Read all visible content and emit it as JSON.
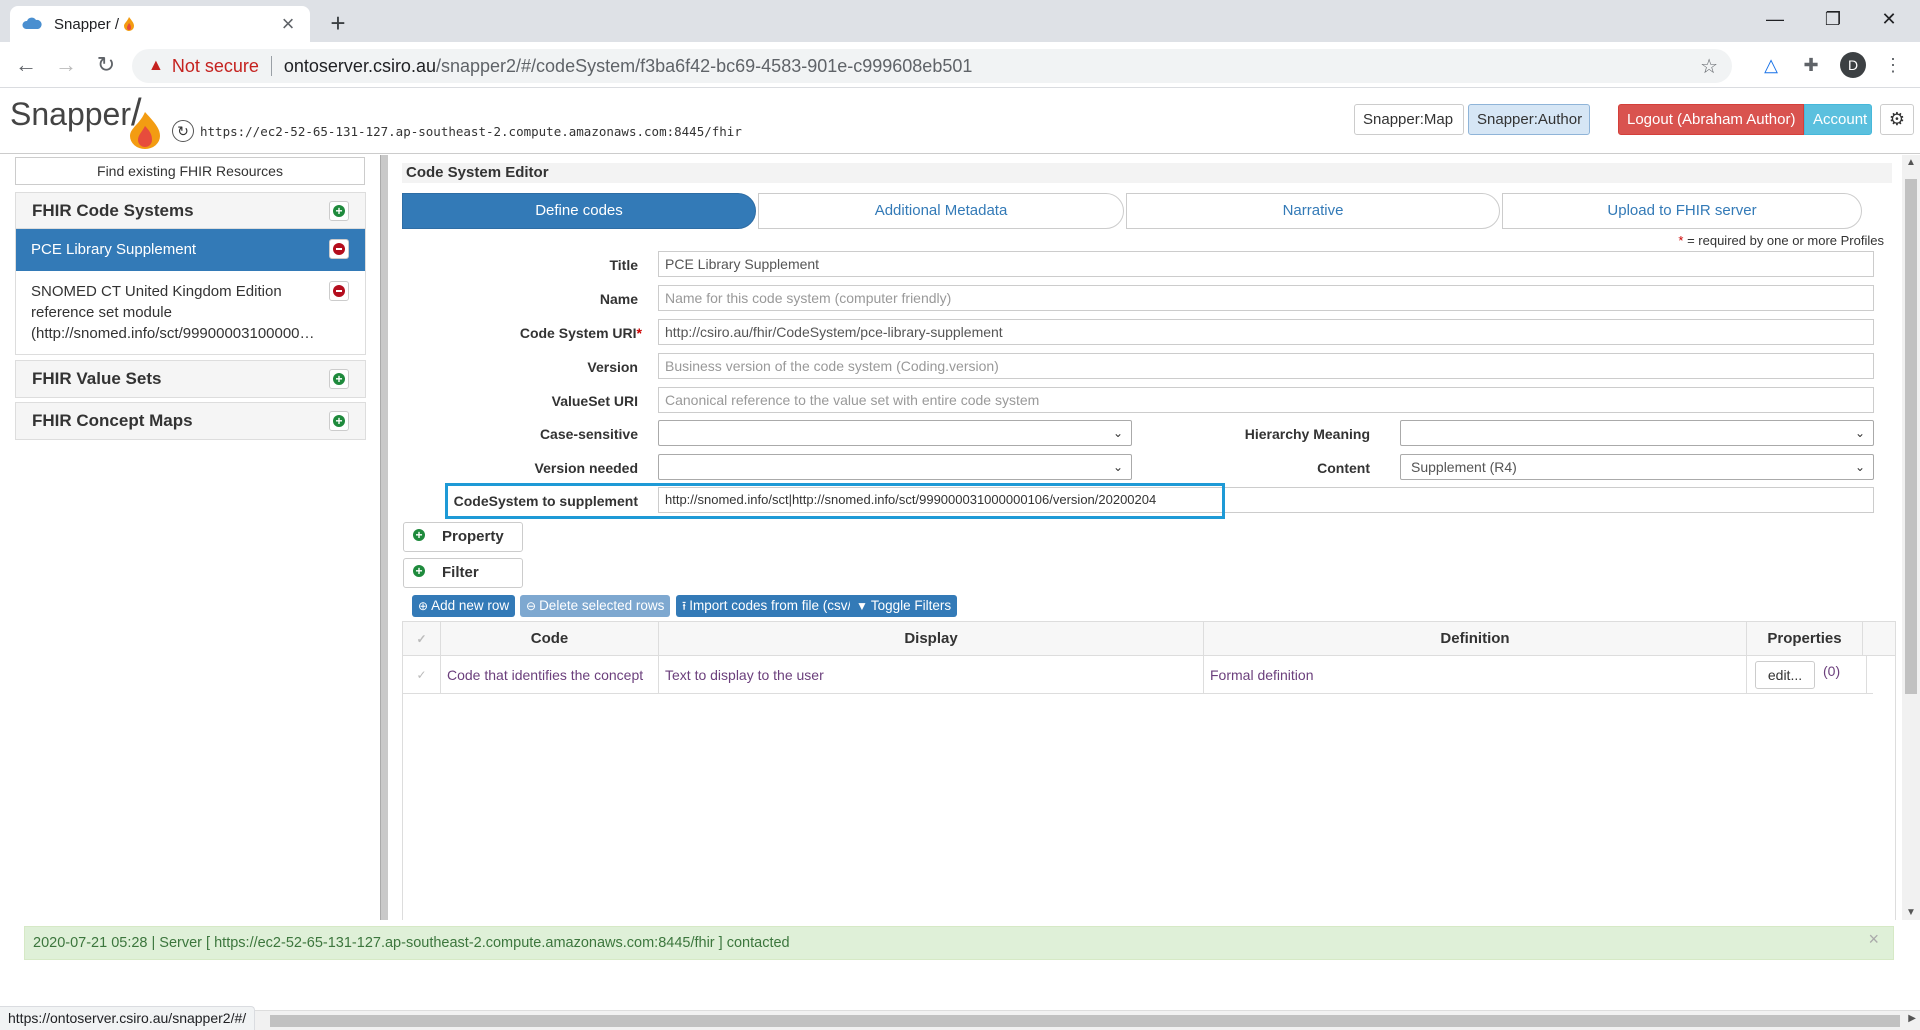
{
  "browser": {
    "tab_title": "Snapper / ",
    "url_warning": "Not secure",
    "url_host": "ontoserver.csiro.au",
    "url_path": "/snapper2/#/codeSystem/f3ba6f42-bc69-4583-901e-c999608eb501",
    "avatar_letter": "D",
    "status_url": "https://ontoserver.csiro.au/snapper2/#/"
  },
  "app": {
    "logo": "Snapper",
    "logo_slash": "/",
    "server_url": "https://ec2-52-65-131-127.ap-southeast-2.compute.amazonaws.com:8445/fhir",
    "btn_map": "Snapper:Map",
    "btn_author": "Snapper:Author",
    "btn_logout": "Logout (Abraham Author)",
    "btn_account": "Account"
  },
  "sidebar": {
    "find_label": "Find existing FHIR Resources",
    "code_systems_title": "FHIR Code Systems",
    "code_systems": [
      "PCE Library Supplement",
      "SNOMED CT United Kingdom Edition reference set module (http://snomed.info/sct/99900003100000…"
    ],
    "value_sets_title": "FHIR Value Sets",
    "concept_maps_title": "FHIR Concept Maps"
  },
  "editor": {
    "title": "Code System Editor",
    "steps": [
      "Define codes",
      "Additional Metadata",
      "Narrative",
      "Upload to FHIR server"
    ],
    "required_star": "*",
    "required_note": " = required by one or more Profiles",
    "fields": {
      "title_label": "Title",
      "title_value": "PCE Library Supplement",
      "name_label": "Name",
      "name_placeholder": "Name for this code system (computer friendly)",
      "uri_label": "Code System URI",
      "uri_value": "http://csiro.au/fhir/CodeSystem/pce-library-supplement",
      "version_label": "Version",
      "version_placeholder": "Business version of the code system (Coding.version)",
      "valueset_label": "ValueSet URI",
      "valueset_placeholder": "Canonical reference to the value set with entire code system",
      "case_label": "Case-sensitive",
      "hierarchy_label": "Hierarchy Meaning",
      "version_needed_label": "Version needed",
      "content_label": "Content",
      "content_value": "Supplement (R4)",
      "supplement_label": "CodeSystem to supplement",
      "supplement_value": "http://snomed.info/sct|http://snomed.info/sct/999000031000000106/version/20200204"
    },
    "property_label": "Property",
    "filter_label": "Filter",
    "toolbar": {
      "add_row": "Add new row",
      "delete_rows": "Delete selected rows",
      "import": "Import codes from file (csv/tsv)",
      "toggle_filters": "Toggle Filters"
    },
    "grid": {
      "headers": [
        "Code",
        "Display",
        "Definition",
        "Properties"
      ],
      "row": {
        "code": "Code that identifies the concept",
        "display": "Text to display to the user",
        "definition": "Formal definition",
        "edit": "edit...",
        "count": "(0)"
      }
    }
  },
  "status": {
    "message": "2020-07-21 05:28 | Server [ https://ec2-52-65-131-127.ap-southeast-2.compute.amazonaws.com:8445/fhir ] contacted"
  },
  "colors": {
    "primary": "#337ab7",
    "danger": "#d9534f",
    "info": "#5bc0de",
    "success_bg": "#dff0d8",
    "highlight": "#1e9ad6"
  }
}
